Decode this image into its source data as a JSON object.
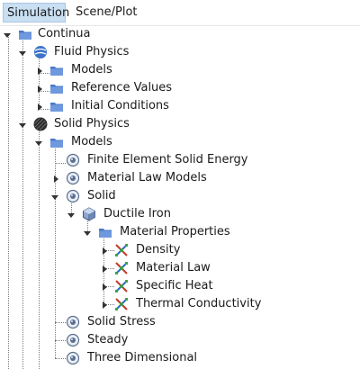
{
  "tabs": [
    {
      "label": "Simulation",
      "active": true
    },
    {
      "label": "Scene/Plot",
      "active": false
    }
  ],
  "colors": {
    "folder": "#4a78c8",
    "folder_tab": "#6f98de",
    "active_tab_bg": "#c9dff2",
    "physics_blue": "#3d74c9",
    "solid_dark": "#2d2d2d"
  },
  "tree": {
    "continua": {
      "label": "Continua",
      "expanded": true
    },
    "fluid_physics": {
      "label": "Fluid Physics",
      "expanded": true
    },
    "fluid_models": {
      "label": "Models",
      "expanded": false
    },
    "reference_values": {
      "label": "Reference Values",
      "expanded": false
    },
    "initial_conditions": {
      "label": "Initial Conditions",
      "expanded": false
    },
    "solid_physics": {
      "label": "Solid Physics",
      "expanded": true
    },
    "solid_models": {
      "label": "Models",
      "expanded": true
    },
    "finite_element_solid_energy": {
      "label": "Finite Element Solid Energy"
    },
    "material_law_models": {
      "label": "Material Law Models",
      "expanded": false
    },
    "solid": {
      "label": "Solid",
      "expanded": true
    },
    "ductile_iron": {
      "label": "Ductile Iron",
      "expanded": true
    },
    "material_properties": {
      "label": "Material Properties",
      "expanded": true
    },
    "density": {
      "label": "Density",
      "expanded": false
    },
    "material_law": {
      "label": "Material Law",
      "expanded": false
    },
    "specific_heat": {
      "label": "Specific Heat",
      "expanded": false
    },
    "thermal_conductivity": {
      "label": "Thermal Conductivity",
      "expanded": false
    },
    "solid_stress": {
      "label": "Solid Stress"
    },
    "steady": {
      "label": "Steady"
    },
    "three_dimensional": {
      "label": "Three Dimensional"
    }
  }
}
